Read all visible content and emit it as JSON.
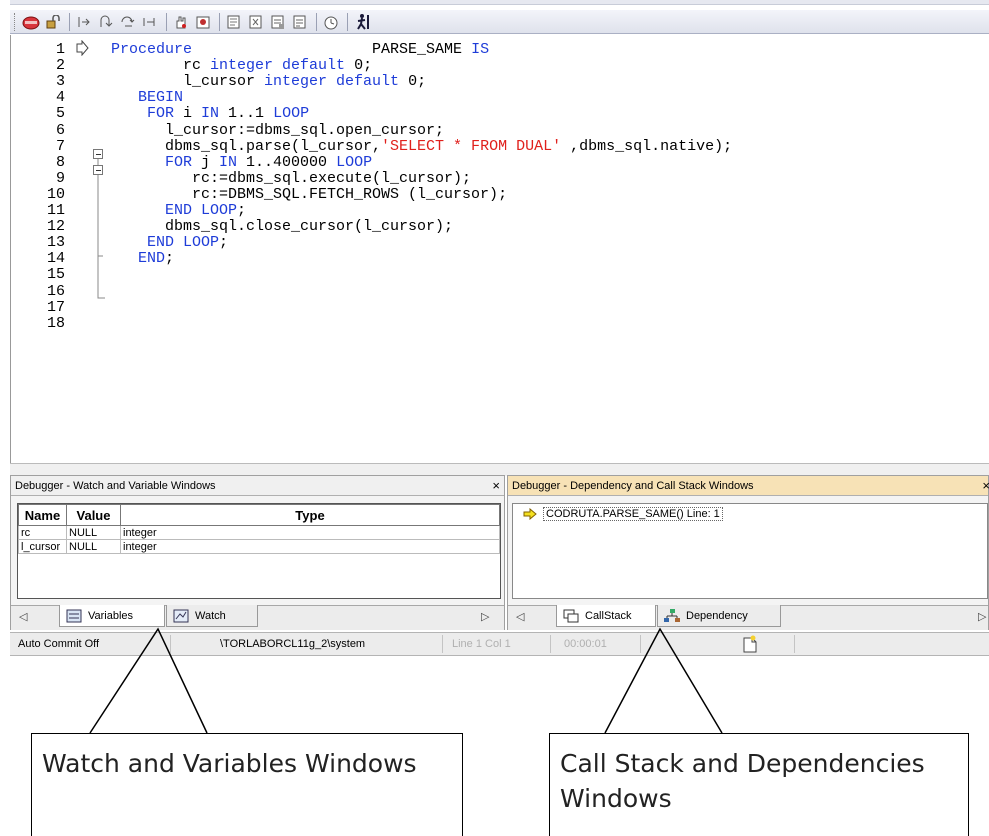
{
  "toolbar": {
    "icons": [
      "debug-run-icon",
      "lock-icon",
      "step-into-icon",
      "step-over-icon",
      "step-out-icon",
      "run-to-cursor-icon",
      "breakpoint-hand-icon",
      "toggle-breakpoint-icon",
      "watch-add-icon",
      "evaluate-icon",
      "inspect-icon",
      "variables-icon",
      "timer-icon",
      "run-man-icon"
    ]
  },
  "editor": {
    "lines": [
      {
        "n": "1",
        "parts": [
          {
            "t": "Procedure",
            "c": "kw"
          },
          {
            "t": "                    PARSE_SAME ",
            "c": ""
          },
          {
            "t": "IS",
            "c": "kw"
          }
        ]
      },
      {
        "n": "2",
        "parts": [
          {
            "t": "        rc ",
            "c": ""
          },
          {
            "t": "integer default",
            "c": "kw"
          },
          {
            "t": " 0;",
            "c": ""
          }
        ]
      },
      {
        "n": "3",
        "parts": [
          {
            "t": "        l_cursor ",
            "c": ""
          },
          {
            "t": "integer default",
            "c": "kw"
          },
          {
            "t": " 0;",
            "c": ""
          }
        ]
      },
      {
        "n": "4",
        "parts": [
          {
            "t": "   BEGIN",
            "c": "kw"
          }
        ]
      },
      {
        "n": "5",
        "parts": [
          {
            "t": "    FOR",
            "c": "kw"
          },
          {
            "t": " i ",
            "c": ""
          },
          {
            "t": "IN",
            "c": "kw"
          },
          {
            "t": " 1..1 ",
            "c": ""
          },
          {
            "t": "LOOP",
            "c": "kw"
          }
        ]
      },
      {
        "n": "6",
        "parts": [
          {
            "t": "      l_cursor:=dbms_sql.open_cursor;",
            "c": ""
          }
        ]
      },
      {
        "n": "7",
        "parts": [
          {
            "t": "      dbms_sql.parse(l_cursor,",
            "c": ""
          },
          {
            "t": "'SELECT * FROM DUAL'",
            "c": "str"
          },
          {
            "t": " ,dbms_sql.native);",
            "c": ""
          }
        ]
      },
      {
        "n": "8",
        "parts": [
          {
            "t": "      FOR",
            "c": "kw"
          },
          {
            "t": " j ",
            "c": ""
          },
          {
            "t": "IN",
            "c": "kw"
          },
          {
            "t": " 1..400000 ",
            "c": ""
          },
          {
            "t": "LOOP",
            "c": "kw"
          }
        ]
      },
      {
        "n": "9",
        "parts": [
          {
            "t": "         rc:=dbms_sql.execute(l_cursor);",
            "c": ""
          }
        ]
      },
      {
        "n": "10",
        "parts": [
          {
            "t": "         rc:=DBMS_SQL.FETCH_ROWS (l_cursor);",
            "c": ""
          }
        ]
      },
      {
        "n": "11",
        "parts": [
          {
            "t": "      END LOOP",
            "c": "kw"
          },
          {
            "t": ";",
            "c": ""
          }
        ]
      },
      {
        "n": "12",
        "parts": [
          {
            "t": "      dbms_sql.close_cursor(l_cursor);",
            "c": ""
          }
        ]
      },
      {
        "n": "13",
        "parts": [
          {
            "t": "    END LOOP",
            "c": "kw"
          },
          {
            "t": ";",
            "c": ""
          }
        ]
      },
      {
        "n": "14",
        "parts": [
          {
            "t": "   END",
            "c": "kw"
          },
          {
            "t": ";",
            "c": ""
          }
        ]
      },
      {
        "n": "15",
        "parts": []
      },
      {
        "n": "16",
        "parts": []
      },
      {
        "n": "17",
        "parts": []
      },
      {
        "n": "18",
        "parts": []
      }
    ]
  },
  "watch_panel": {
    "title": "Debugger  - Watch and Variable Windows",
    "close": "×",
    "columns": [
      "Name",
      "Value",
      "Type"
    ],
    "rows": [
      {
        "name": "rc",
        "value": "NULL",
        "type": "integer"
      },
      {
        "name": "l_cursor",
        "value": "NULL",
        "type": "integer"
      }
    ],
    "tabs": [
      "Variables",
      "Watch"
    ],
    "left_arrow": "◁",
    "right_arrow": "▷"
  },
  "callstack_panel": {
    "title": "Debugger - Dependency and Call Stack Windows",
    "close": "×",
    "item": "CODRUTA.PARSE_SAME() Line: 1",
    "tabs": [
      "CallStack",
      "Dependency"
    ],
    "left_arrow": "◁",
    "right_arrow": "▷"
  },
  "statusbar": {
    "commit": "Auto Commit Off",
    "connection": "\\TORLABORCL11g_2\\system",
    "position": "Line 1 Col 1",
    "time": "00:00:01"
  },
  "callouts": {
    "left": "Watch and Variables Windows",
    "right": "Call Stack and Dependencies Windows"
  },
  "colors": {
    "keyword": "#1e3cd8",
    "string": "#e0201c",
    "active_title": "#f7e2b6"
  }
}
